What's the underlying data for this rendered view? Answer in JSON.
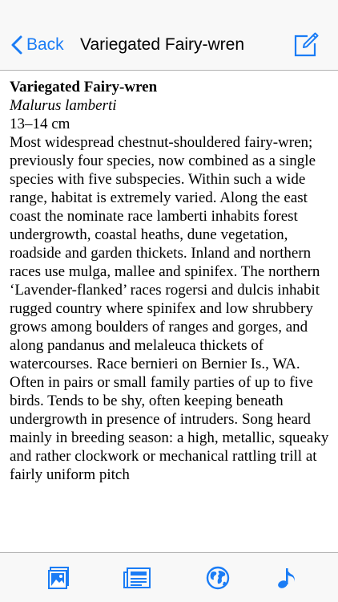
{
  "navbar": {
    "back_label": "Back",
    "title": "Variegated Fairy-wren"
  },
  "species": {
    "common_name": "Variegated Fairy-wren",
    "scientific_name": "Malurus lamberti",
    "size": "13–14 cm",
    "description": "Most widespread chestnut-shouldered fairy-wren; previously four species, now combined as a single species with five subspecies. Within such a wide range, habitat is extremely varied. Along the east coast the nominate race lamberti inhabits forest undergrowth, coastal heaths, dune vegetation, roadside and garden thickets. Inland and northern races use mulga, mallee and spinifex. The northern ‘Lavender-flanked’ races rogersi and dulcis inhabit rugged country where spinifex and low shrubbery grows among boulders of ranges and gorges, and along pandanus and melaleuca thickets of watercourses. Race bernieri on Bernier Is., WA. Often in pairs or small family parties of up to five birds. Tends to be shy, often keeping beneath undergrowth in presence of intruders. Song heard mainly in breeding season: a high, metallic, squeaky and rather clockwork or mechanical rattling trill at fairly uniform pitch"
  },
  "colors": {
    "accent": "#1a7cf5",
    "bar_background": "#f8f8f8"
  },
  "toolbar": {
    "icons": [
      "image-icon",
      "article-icon",
      "globe-icon",
      "music-note-icon"
    ]
  }
}
